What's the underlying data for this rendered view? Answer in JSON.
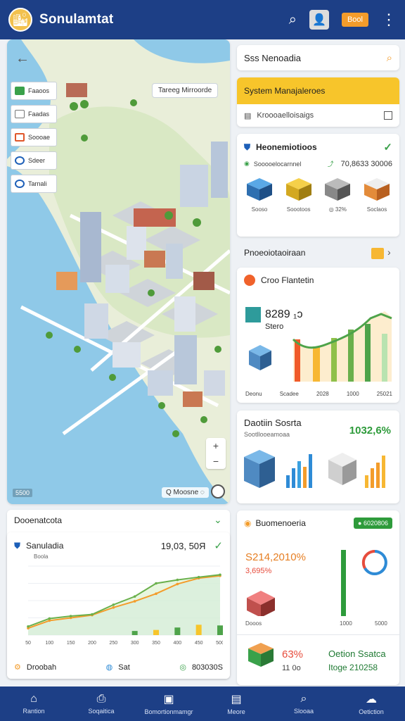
{
  "header": {
    "app_title": "Sonulamtat",
    "pill_label": "Bool",
    "logo_icon": "🏙",
    "avatar_icon": "👤"
  },
  "map": {
    "legend": [
      {
        "label": "Faaoos",
        "color": "#3aa14a"
      },
      {
        "label": "Faadas",
        "color": "#777"
      },
      {
        "label": "Soooae",
        "color": "#e0572b"
      },
      {
        "label": "Sdeer",
        "color": "#1d5fb8"
      },
      {
        "label": "Tarnali",
        "color": "#1d5fb8"
      }
    ],
    "callout_label": "Tareeg Mirroorde",
    "footer_left": "5500",
    "footer_right": "Q Moosne ◌"
  },
  "search": {
    "text": "Sss Nenoadia"
  },
  "system": {
    "title": "System Manajaleroes",
    "row_text": "Kroooaelloisaigs"
  },
  "recommendations": {
    "title": "Heonemiotioos",
    "sub_label": "Sooooelocarnnel",
    "sub_value": "70,8633 30006",
    "items": [
      {
        "label": "Sooso",
        "color": "#2e8bd6"
      },
      {
        "label": "Soootoos",
        "color": "#f1c40f"
      },
      {
        "label": "◎ 32%",
        "color": "#888"
      },
      {
        "label": "Soclaos",
        "color": "#e67e22"
      }
    ]
  },
  "growth_section": {
    "label": "Pnoeoiotaoiraan"
  },
  "growth": {
    "title": "Croo Flantetin",
    "metric_value": "8289 ₁ɔ",
    "metric_label": "Stero",
    "axis_labels": [
      "Deonu",
      "Scadee",
      "2028",
      "1000",
      "25021"
    ]
  },
  "summary": {
    "title": "Daotiin Sosrta",
    "percent": "1032,6%",
    "subtitle": "Sootllooeamoaa"
  },
  "economy": {
    "title": "Buomenoeria",
    "badge": "● 6020806",
    "value1": "S214,2010%",
    "value2": "3,695%",
    "b_label1": "Dooos",
    "b_label2": "1000",
    "b_label3": "5000",
    "pct": "63%",
    "pct_sub": "11 0o",
    "right_title": "Oetion Ssatca",
    "right_value": "Itoge 210258"
  },
  "population_section": {
    "label": "Dooenatcota"
  },
  "population": {
    "title": "Sanuladia",
    "subtitle": "Boola",
    "value": "19,03, 50Я",
    "foot_left": "Droobah",
    "foot_mid": "Sat",
    "foot_right": "803030S"
  },
  "chart_data": {
    "type": "line",
    "title": "",
    "x": [
      "50",
      "100",
      "150",
      "200",
      "250",
      "300",
      "350",
      "400",
      "450",
      "500"
    ],
    "series": [
      {
        "name": "",
        "values": [
          20,
          42,
          50,
          58,
          80,
          98,
          120,
          148,
          165,
          172
        ]
      },
      {
        "name": "",
        "values": [
          25,
          48,
          55,
          60,
          88,
          112,
          150,
          160,
          168,
          175
        ]
      }
    ],
    "bars": [
      0,
      0,
      0,
      0,
      0,
      12,
      15,
      22,
      30,
      28
    ],
    "ylim": [
      0,
      200
    ]
  },
  "nav": [
    {
      "label": "Rantion",
      "icon": "⌂"
    },
    {
      "label": "Soqaitica",
      "icon": "⎙"
    },
    {
      "label": "Bomortionmamgr",
      "icon": "▣"
    },
    {
      "label": "Meore",
      "icon": "▤"
    },
    {
      "label": "Slooaa",
      "icon": "⌕"
    },
    {
      "label": "Oetiction",
      "icon": "☁"
    }
  ]
}
